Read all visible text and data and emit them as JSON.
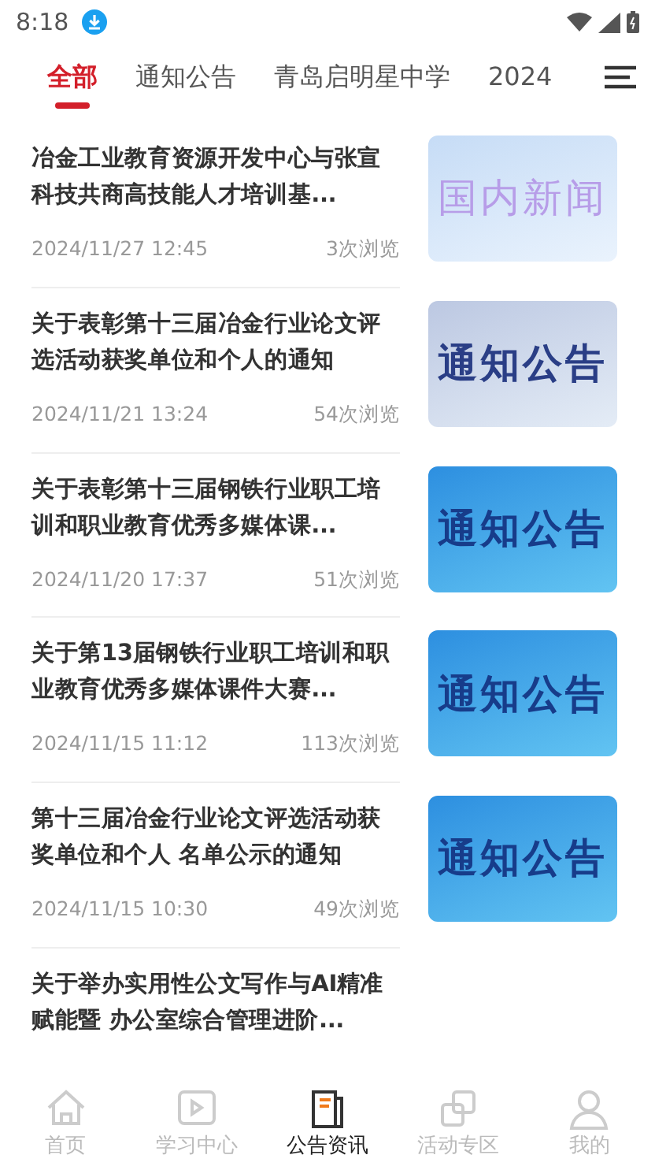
{
  "status_bar": {
    "time": "8:18"
  },
  "tabs": [
    {
      "label": "全部",
      "selected": true
    },
    {
      "label": "通知公告",
      "selected": false
    },
    {
      "label": "青岛启明星中学",
      "selected": false
    },
    {
      "label": "2024",
      "selected": false
    }
  ],
  "articles": [
    {
      "title": "冶金工业教育资源开发中心与张宣科技共商高技能人才培训基...",
      "date": "2024/11/27 12:45",
      "views": "3次浏览",
      "thumbnail": {
        "label": "国内新闻",
        "kind": "news"
      }
    },
    {
      "title": "关于表彰第十三届冶金行业论文评选活动获奖单位和个人的通知",
      "date": "2024/11/21 13:24",
      "views": "54次浏览",
      "thumbnail": {
        "label": "通知公告",
        "kind": "notice-grey"
      }
    },
    {
      "title": "关于表彰第十三届钢铁行业职工培训和职业教育优秀多媒体课...",
      "date": "2024/11/20 17:37",
      "views": "51次浏览",
      "thumbnail": {
        "label": "通知公告",
        "kind": "notice"
      }
    },
    {
      "title": "关于第13届钢铁行业职工培训和职业教育优秀多媒体课件大赛...",
      "date": "2024/11/15 11:12",
      "views": "113次浏览",
      "thumbnail": {
        "label": "通知公告",
        "kind": "notice"
      }
    },
    {
      "title": "第十三届冶金行业论文评选活动获奖单位和个人 名单公示的通知",
      "date": "2024/11/15 10:30",
      "views": "49次浏览",
      "thumbnail": {
        "label": "通知公告",
        "kind": "notice"
      }
    },
    {
      "title": "关于举办实用性公文写作与AI精准赋能暨 办公室综合管理进阶..."
    }
  ],
  "bottom_nav": [
    {
      "label": "首页",
      "kind": "home",
      "selected": false
    },
    {
      "label": "学习中心",
      "kind": "play",
      "selected": false
    },
    {
      "label": "公告资讯",
      "kind": "doc",
      "selected": true
    },
    {
      "label": "活动专区",
      "kind": "links",
      "selected": false
    },
    {
      "label": "我的",
      "kind": "person",
      "selected": false
    }
  ]
}
